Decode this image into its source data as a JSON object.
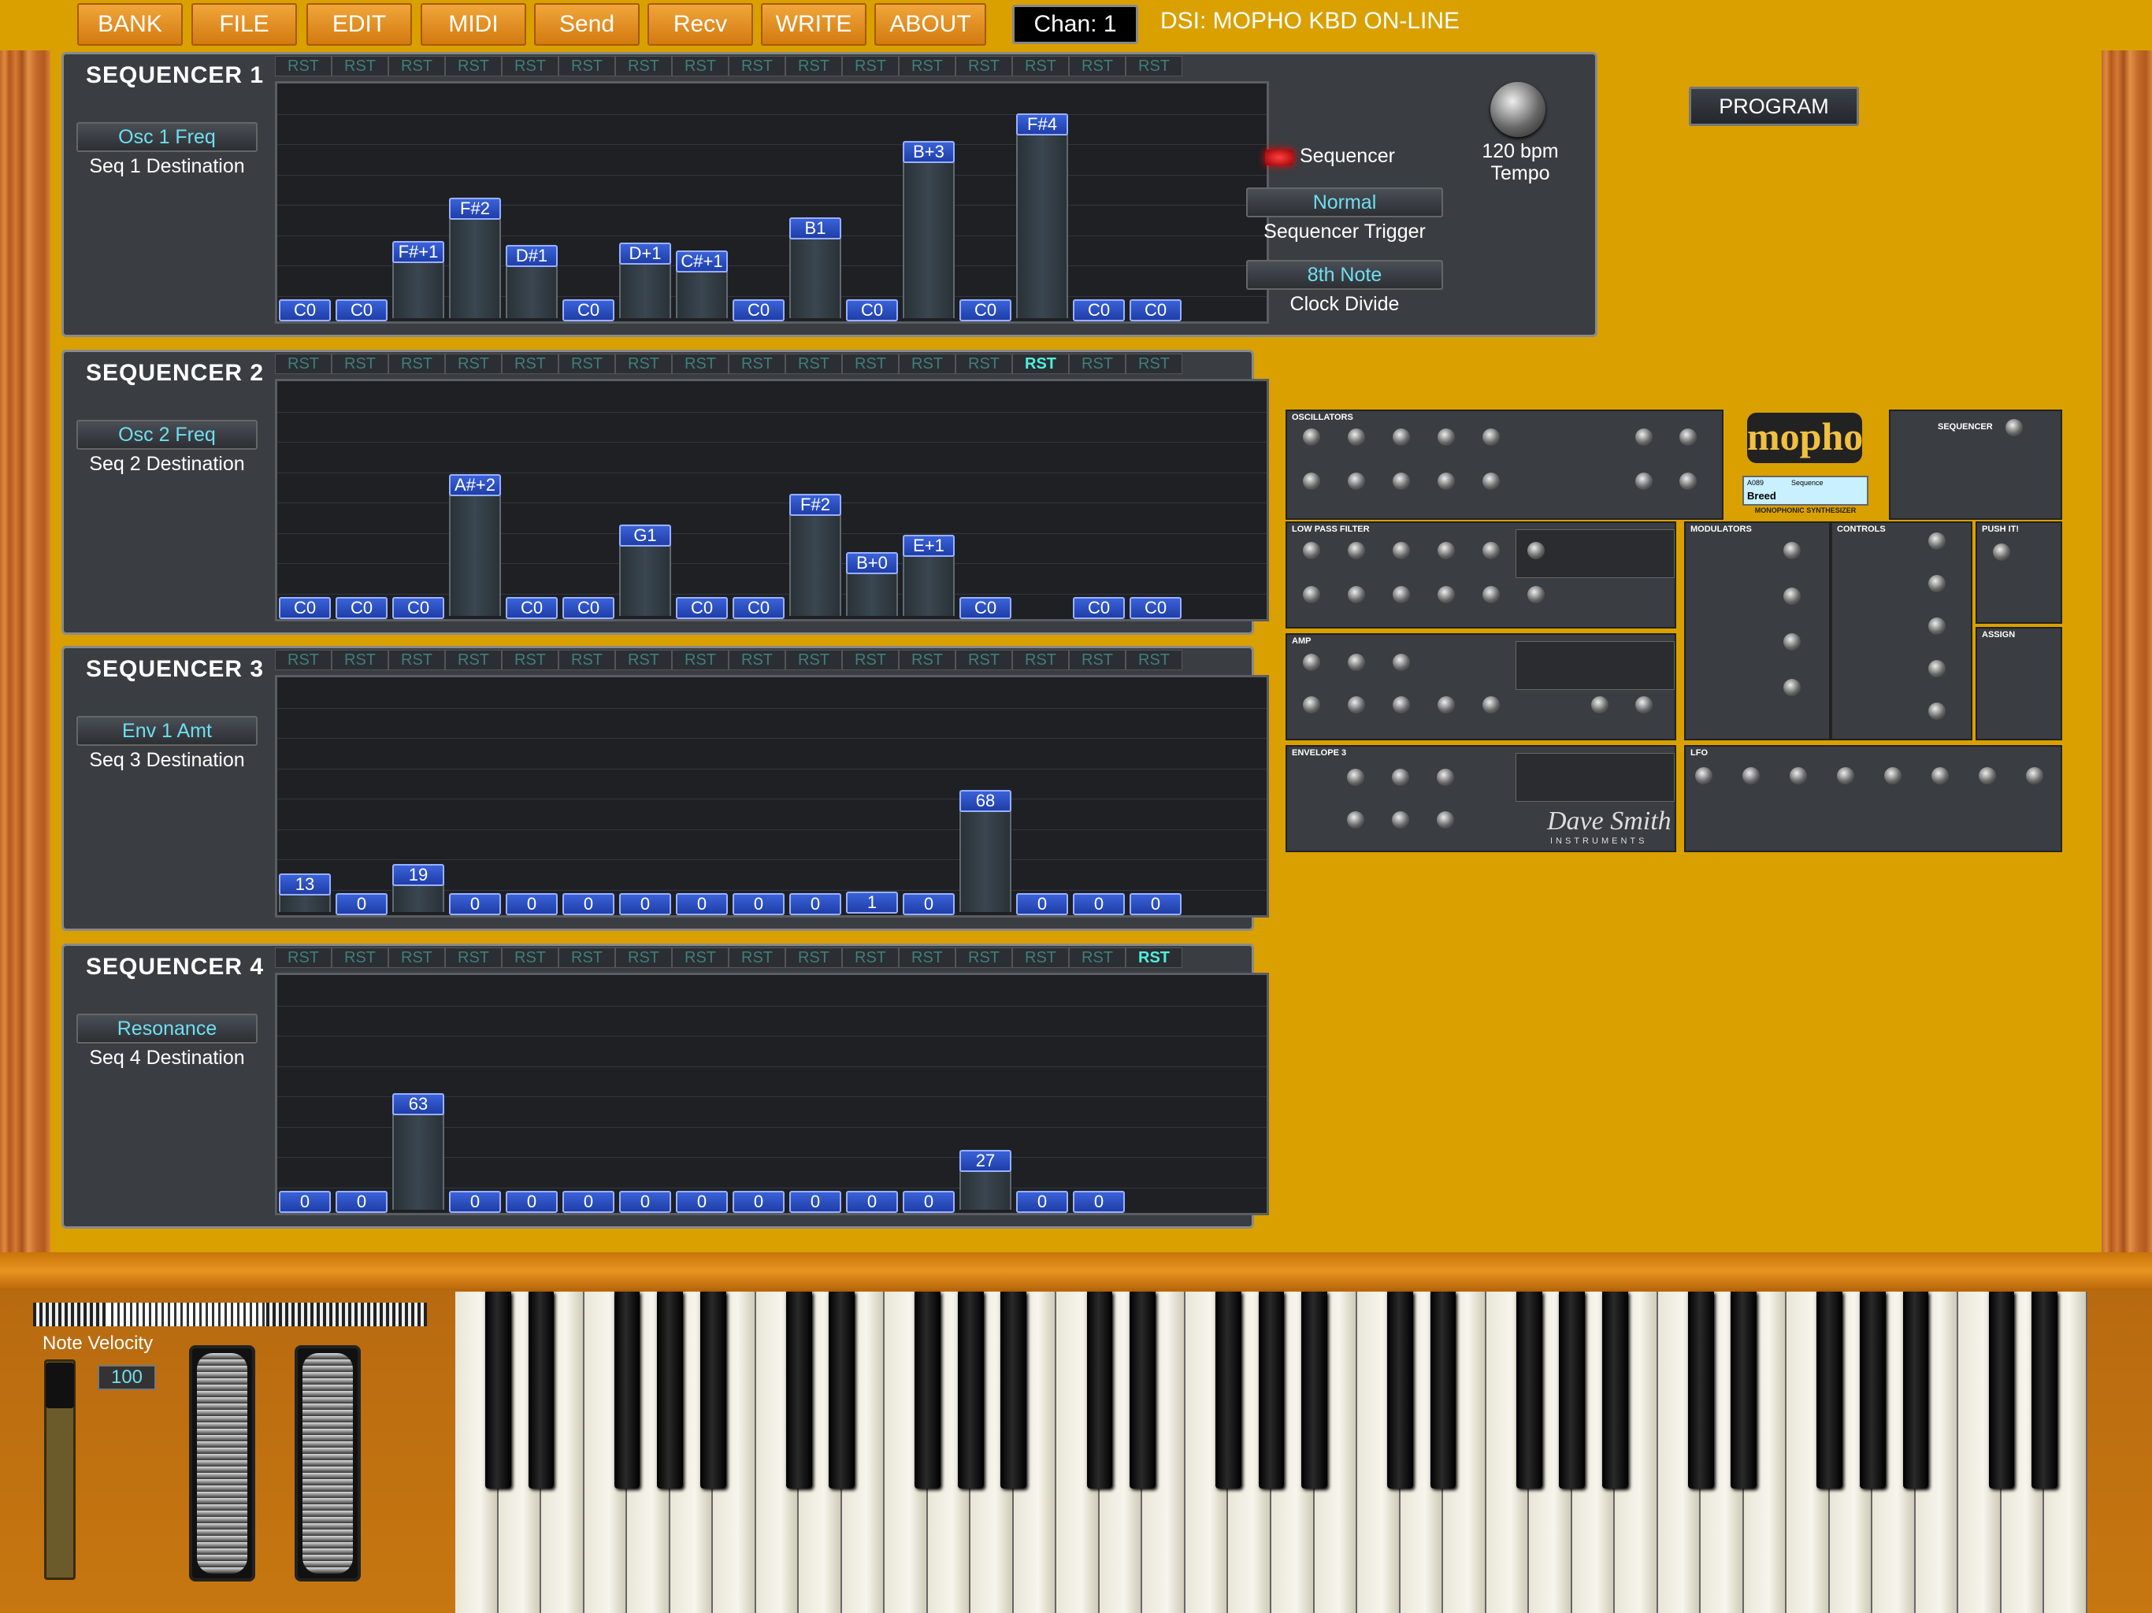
{
  "menu": [
    "BANK",
    "FILE",
    "EDIT",
    "MIDI",
    "Send",
    "Recv",
    "WRITE",
    "ABOUT"
  ],
  "channel": "Chan: 1",
  "status": "DSI:  MOPHO KBD ON-LINE",
  "rst_label": "RST",
  "sequencers": [
    {
      "title": "SEQUENCER  1",
      "destination": "Osc 1 Freq",
      "destination_caption": "Seq 1 Destination",
      "active_rst": -1,
      "steps": [
        {
          "label": "C0",
          "level": 0
        },
        {
          "label": "C0",
          "level": 0
        },
        {
          "label": "F#+1",
          "level": 0.3
        },
        {
          "label": "F#2",
          "level": 0.52
        },
        {
          "label": "D#1",
          "level": 0.28
        },
        {
          "label": "C0",
          "level": 0
        },
        {
          "label": "D+1",
          "level": 0.29
        },
        {
          "label": "C#+1",
          "level": 0.25
        },
        {
          "label": "C0",
          "level": 0
        },
        {
          "label": "B1",
          "level": 0.42
        },
        {
          "label": "C0",
          "level": 0
        },
        {
          "label": "B+3",
          "level": 0.81
        },
        {
          "label": "C0",
          "level": 0
        },
        {
          "label": "F#4",
          "level": 0.95
        },
        {
          "label": "C0",
          "level": 0
        },
        {
          "label": "C0",
          "level": 0
        }
      ]
    },
    {
      "title": "SEQUENCER  2",
      "destination": "Osc 2 Freq",
      "destination_caption": "Seq 2 Destination",
      "active_rst": 13,
      "steps": [
        {
          "label": "C0",
          "level": 0
        },
        {
          "label": "C0",
          "level": 0
        },
        {
          "label": "C0",
          "level": 0
        },
        {
          "label": "A#+2",
          "level": 0.63
        },
        {
          "label": "C0",
          "level": 0
        },
        {
          "label": "C0",
          "level": 0
        },
        {
          "label": "G1",
          "level": 0.37
        },
        {
          "label": "C0",
          "level": 0
        },
        {
          "label": "C0",
          "level": 0
        },
        {
          "label": "F#2",
          "level": 0.53
        },
        {
          "label": "B+0",
          "level": 0.23
        },
        {
          "label": "E+1",
          "level": 0.32
        },
        {
          "label": "C0",
          "level": 0
        },
        {
          "label": "",
          "level": null
        },
        {
          "label": "C0",
          "level": 0
        },
        {
          "label": "C0",
          "level": 0
        }
      ]
    },
    {
      "title": "SEQUENCER  3",
      "destination": "Env 1 Amt",
      "destination_caption": "Seq 3 Destination",
      "active_rst": -1,
      "steps": [
        {
          "label": "13",
          "level": 0.1
        },
        {
          "label": "0",
          "level": 0
        },
        {
          "label": "19",
          "level": 0.15
        },
        {
          "label": "0",
          "level": 0
        },
        {
          "label": "0",
          "level": 0
        },
        {
          "label": "0",
          "level": 0
        },
        {
          "label": "0",
          "level": 0
        },
        {
          "label": "0",
          "level": 0
        },
        {
          "label": "0",
          "level": 0
        },
        {
          "label": "0",
          "level": 0
        },
        {
          "label": "1",
          "level": 0.01
        },
        {
          "label": "0",
          "level": 0
        },
        {
          "label": "68",
          "level": 0.53
        },
        {
          "label": "0",
          "level": 0
        },
        {
          "label": "0",
          "level": 0
        },
        {
          "label": "0",
          "level": 0
        }
      ]
    },
    {
      "title": "SEQUENCER  4",
      "destination": "Resonance",
      "destination_caption": "Seq 4 Destination",
      "active_rst": 15,
      "steps": [
        {
          "label": "0",
          "level": 0
        },
        {
          "label": "0",
          "level": 0
        },
        {
          "label": "63",
          "level": 0.5
        },
        {
          "label": "0",
          "level": 0
        },
        {
          "label": "0",
          "level": 0
        },
        {
          "label": "0",
          "level": 0
        },
        {
          "label": "0",
          "level": 0
        },
        {
          "label": "0",
          "level": 0
        },
        {
          "label": "0",
          "level": 0
        },
        {
          "label": "0",
          "level": 0
        },
        {
          "label": "0",
          "level": 0
        },
        {
          "label": "0",
          "level": 0
        },
        {
          "label": "27",
          "level": 0.21
        },
        {
          "label": "0",
          "level": 0
        },
        {
          "label": "0",
          "level": 0
        },
        {
          "label": "",
          "level": null
        }
      ]
    }
  ],
  "seq_controls": {
    "sequencer_label": "Sequencer",
    "tempo_value": "120 bpm",
    "tempo_label": "Tempo",
    "trigger_value": "Normal",
    "trigger_label": "Sequencer Trigger",
    "clock_value": "8th Note",
    "clock_label": "Clock Divide"
  },
  "program_button": "PROGRAM",
  "panel": {
    "oscillators": "OSCILLATORS",
    "lpf": "LOW PASS FILTER",
    "amp": "AMP",
    "envelope3": "ENVELOPE 3",
    "modulators": "MODULATORS",
    "controls": "CONTROLS",
    "push_it": "PUSH IT!",
    "assign": "ASSIGN",
    "lfo": "LFO",
    "sequencer": "SEQUENCER",
    "logo": "mopho",
    "subtitle": "MONOPHONIC SYNTHESIZER",
    "brand": "Dave Smith",
    "brand_sub": "INSTRUMENTS",
    "preset_name": "Breed",
    "preset_num": "A089",
    "preset_cat": "Sequence"
  },
  "keyboard": {
    "velocity_label": "Note Velocity",
    "velocity_value": "100"
  }
}
